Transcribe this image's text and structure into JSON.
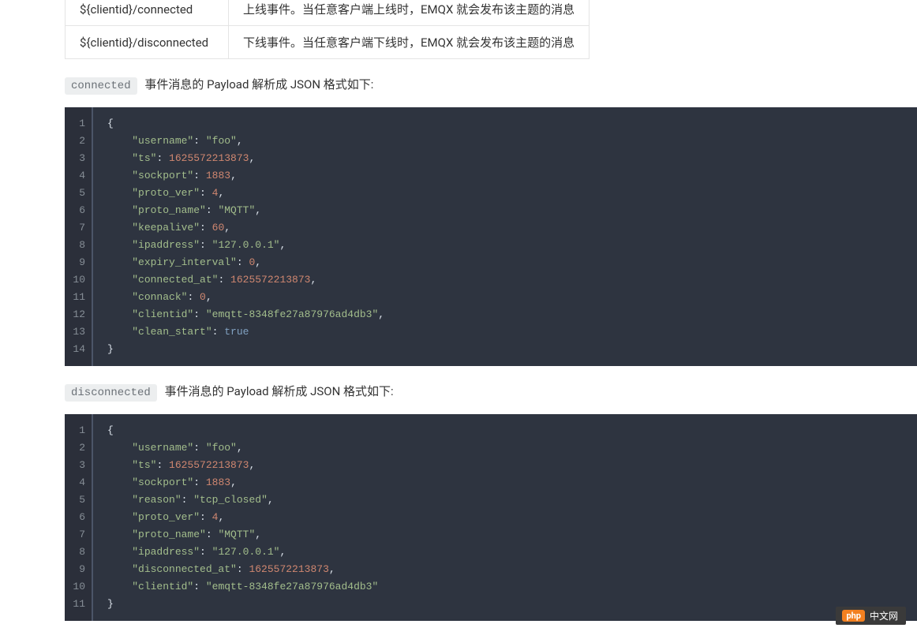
{
  "table": {
    "rows": [
      {
        "topic": "${clientid}/connected",
        "desc": "上线事件。当任意客户端上线时，EMQX 就会发布该主题的消息"
      },
      {
        "topic": "${clientid}/disconnected",
        "desc": "下线事件。当任意客户端下线时，EMQX 就会发布该主题的消息"
      }
    ]
  },
  "para1": {
    "code": "connected",
    "text": "事件消息的 Payload 解析成 JSON 格式如下:"
  },
  "para2": {
    "code": "disconnected",
    "text": "事件消息的 Payload 解析成 JSON 格式如下:"
  },
  "connected_payload": {
    "username": "foo",
    "ts": 1625572213873,
    "sockport": 1883,
    "proto_ver": 4,
    "proto_name": "MQTT",
    "keepalive": 60,
    "ipaddress": "127.0.0.1",
    "expiry_interval": 0,
    "connected_at": 1625572213873,
    "connack": 0,
    "clientid": "emqtt-8348fe27a87976ad4db3",
    "clean_start": true
  },
  "disconnected_payload": {
    "username": "foo",
    "ts": 1625572213873,
    "sockport": 1883,
    "reason": "tcp_closed",
    "proto_ver": 4,
    "proto_name": "MQTT",
    "ipaddress": "127.0.0.1",
    "disconnected_at": 1625572213873,
    "clientid": "emqtt-8348fe27a87976ad4db3"
  },
  "watermark": {
    "logo": "php",
    "suffix": "中文网"
  }
}
